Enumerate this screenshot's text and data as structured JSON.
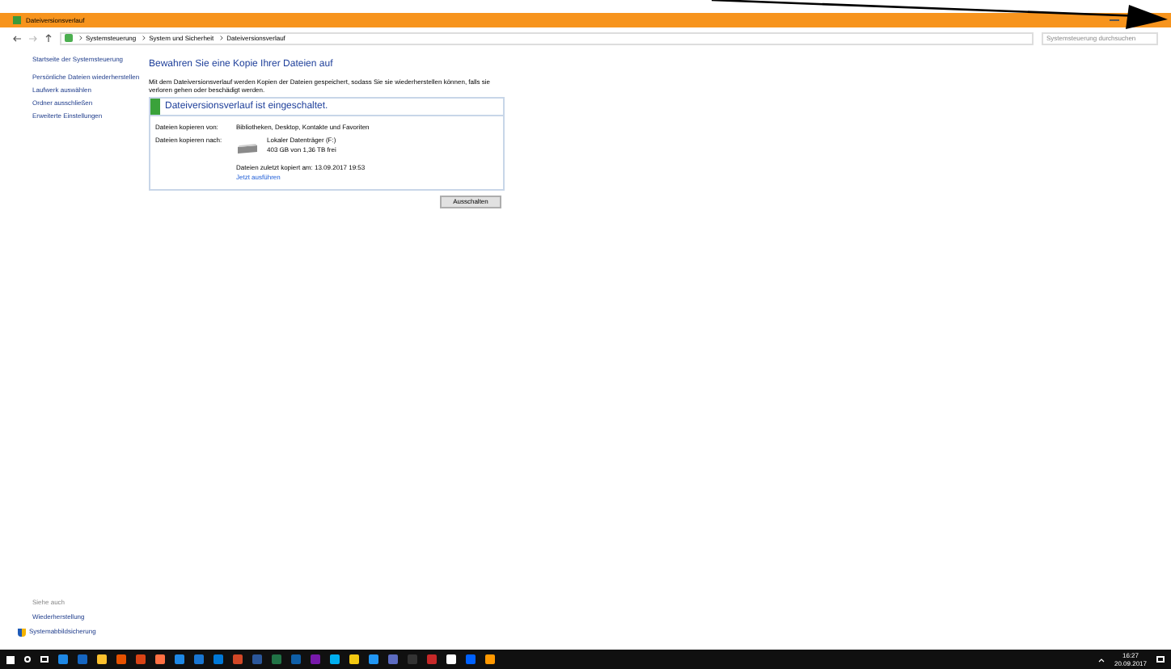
{
  "window": {
    "title": "Dateiversionsverlauf"
  },
  "address_bar": {
    "breadcrumbs": [
      "Systemsteuerung",
      "System und Sicherheit",
      "Dateiversionsverlauf"
    ],
    "search": {
      "placeholder": "Systemsteuerung durchsuchen"
    }
  },
  "sidebar": {
    "items": [
      "Startseite der Systemsteuerung",
      "Persönliche Dateien wiederherstellen",
      "Laufwerk auswählen",
      "Ordner ausschließen",
      "Erweiterte Einstellungen"
    ],
    "see_also": {
      "heading": "Siehe auch",
      "links": [
        {
          "label": "Wiederherstellung",
          "shield": false
        },
        {
          "label": "Systemabbildsicherung",
          "shield": true
        }
      ]
    }
  },
  "main": {
    "heading": "Bewahren Sie eine Kopie Ihrer Dateien auf",
    "description": "Mit dem Dateiversionsverlauf werden Kopien der Dateien gespeichert, sodass Sie sie wiederherstellen können, falls sie verloren gehen oder beschädigt werden.",
    "status": {
      "on": true,
      "text": "Dateiversionsverlauf ist eingeschaltet."
    },
    "copy_from_label": "Dateien kopieren von:",
    "copy_from_value": "Bibliotheken, Desktop, Kontakte und Favoriten",
    "copy_to_label": "Dateien kopieren nach:",
    "drive_name": "Lokaler Datenträger (F:)",
    "drive_space": "403 GB von 1,36 TB frei",
    "last_copied": "Dateien zuletzt kopiert am: 13.09.2017 19:53",
    "run_now": "Jetzt ausführen",
    "button": "Ausschalten"
  },
  "taskbar": {
    "time": "16:27",
    "date": "20.09.2017"
  }
}
